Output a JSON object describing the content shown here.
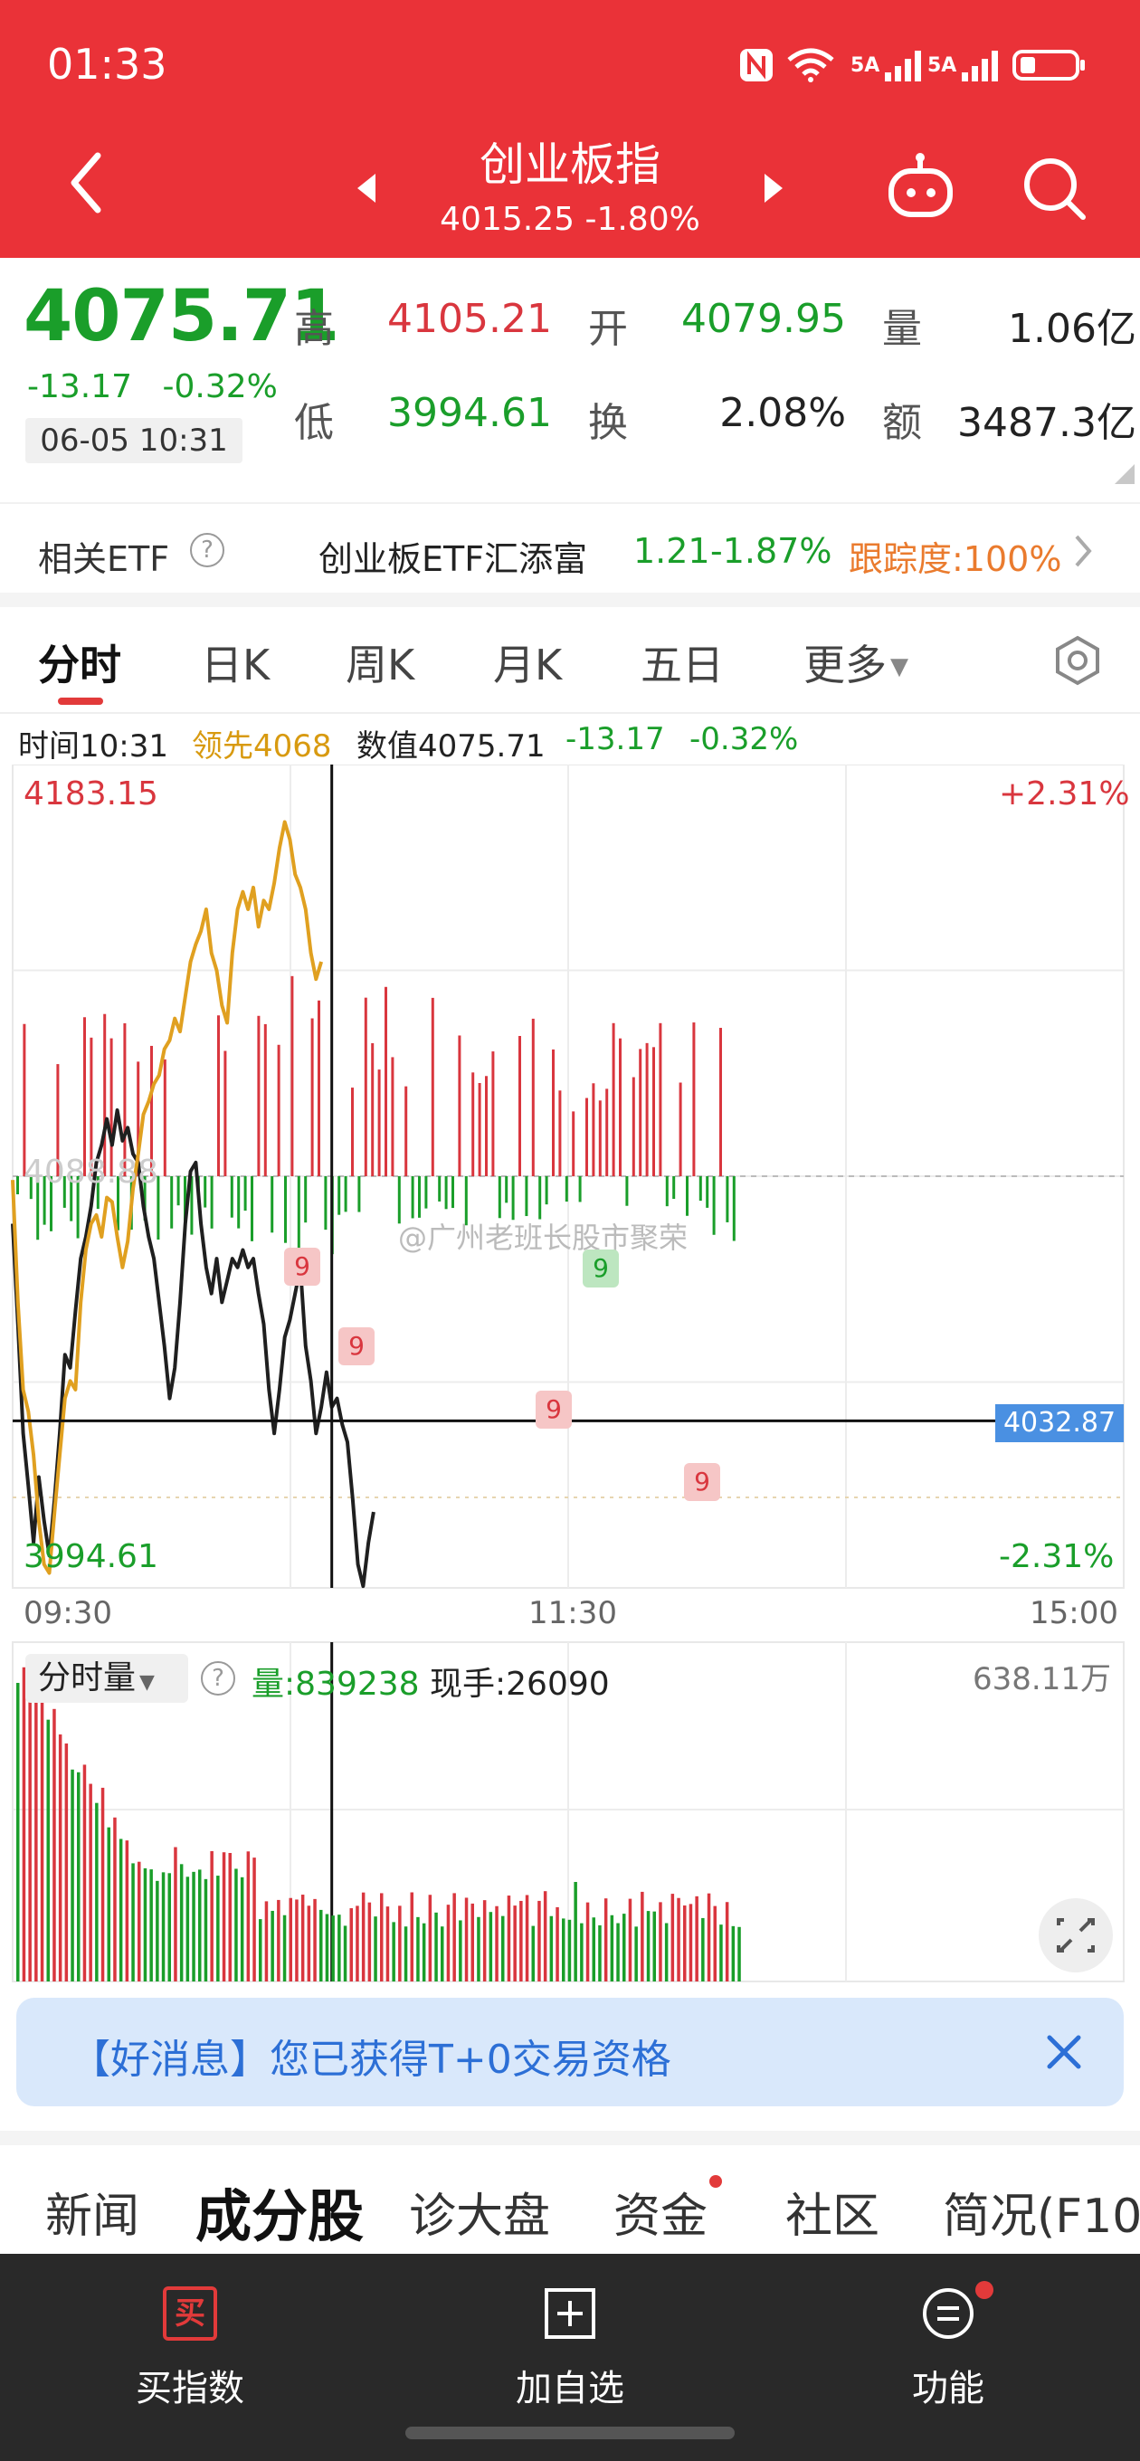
{
  "status_bar": {
    "time": "01:33",
    "net1": "5A",
    "net2": "5A"
  },
  "header": {
    "title": "创业板指",
    "subtitle": "4015.25 -1.80%"
  },
  "quote": {
    "price": "4075.71",
    "change": "-13.17",
    "change_pct": "-0.32%",
    "datetime": "06-05 10:31",
    "stats": [
      {
        "label": "高",
        "value": "4105.21",
        "color": "#d9363e"
      },
      {
        "label": "开",
        "value": "4079.95",
        "color": "#1a9e2a"
      },
      {
        "label": "量",
        "value": "1.06亿",
        "color": "#222222"
      },
      {
        "label": "低",
        "value": "3994.61",
        "color": "#1a9e2a"
      },
      {
        "label": "换",
        "value": "2.08%",
        "color": "#222222"
      },
      {
        "label": "额",
        "value": "3487.3亿",
        "color": "#222222"
      }
    ]
  },
  "etf": {
    "label": "相关ETF",
    "help": "?",
    "name": "创业板ETF汇添富",
    "price": "1.21",
    "change": "-1.87%",
    "tracking": "跟踪度:100%"
  },
  "tabs": [
    "分时",
    "日K",
    "周K",
    "月K",
    "五日",
    "更多"
  ],
  "info": {
    "time": "时间10:31",
    "lead": "领先4068",
    "value": "数值4075.71",
    "change": "-13.17",
    "change_pct": "-0.32%"
  },
  "chart_data": {
    "type": "line",
    "y_left_max": "4183.15",
    "y_left_min": "3994.61",
    "y_right_max": "+2.31%",
    "y_right_min": "-2.31%",
    "crosshair_value": "4032.87",
    "faded_label": "4088.88",
    "x_ticks": [
      "09:30",
      "11:30",
      "15:00"
    ],
    "ylim": [
      3994.61,
      4183.15
    ],
    "prev_close": 4088.88,
    "series": [
      {
        "color": "#1f1f1f",
        "values": [
          4078,
          4055,
          4030,
          4018,
          4005,
          4020,
          4010,
          4002,
          4015,
          4030,
          4048,
          4045,
          4058,
          4070,
          4075,
          4082,
          4092,
          4096,
          4102,
          4096,
          4104,
          4097,
          4100,
          4094,
          4092,
          4082,
          4075,
          4070,
          4060,
          4050,
          4038,
          4045,
          4060,
          4078,
          4090,
          4092,
          4078,
          4068,
          4062,
          4070,
          4060,
          4065,
          4070,
          4068,
          4072,
          4068,
          4070,
          4062,
          4055,
          4040,
          4030,
          4040,
          4052,
          4056,
          4062,
          4068,
          4050,
          4042,
          4030,
          4036,
          4044,
          4036,
          4038,
          4032,
          4028,
          4015,
          4000,
          3995,
          4005,
          4012
        ]
      },
      {
        "color": "#e0a020",
        "values": [
          4088,
          4060,
          4040,
          4035,
          4025,
          4010,
          4000,
          3998,
          4012,
          4025,
          4038,
          4042,
          4040,
          4060,
          4072,
          4078,
          4080,
          4075,
          4084,
          4083,
          4075,
          4068,
          4074,
          4086,
          4094,
          4103,
          4106,
          4110,
          4112,
          4118,
          4120,
          4125,
          4122,
          4130,
          4138,
          4142,
          4145,
          4150,
          4140,
          4136,
          4128,
          4124,
          4140,
          4150,
          4154,
          4150,
          4155,
          4146,
          4152,
          4150,
          4156,
          4164,
          4170,
          4166,
          4158,
          4155,
          4150,
          4140,
          4134,
          4138
        ]
      }
    ]
  },
  "watermark": "@广州老班长股市聚荣",
  "markers": [
    "9",
    "9",
    "9",
    "9",
    "9"
  ],
  "vol_chart": {
    "label": "分时量",
    "help": "?",
    "volume": "量:839238",
    "hand": "现手:26090",
    "max": "638.11万"
  },
  "banner": {
    "text": "【好消息】您已获得T+0交易资格"
  },
  "subtabs": [
    "新闻",
    "成分股",
    "诊大盘",
    "资金",
    "社区",
    "简况(F10)"
  ],
  "bottom": [
    {
      "label": "买指数",
      "icon": "买"
    },
    {
      "label": "加自选"
    },
    {
      "label": "功能"
    }
  ]
}
